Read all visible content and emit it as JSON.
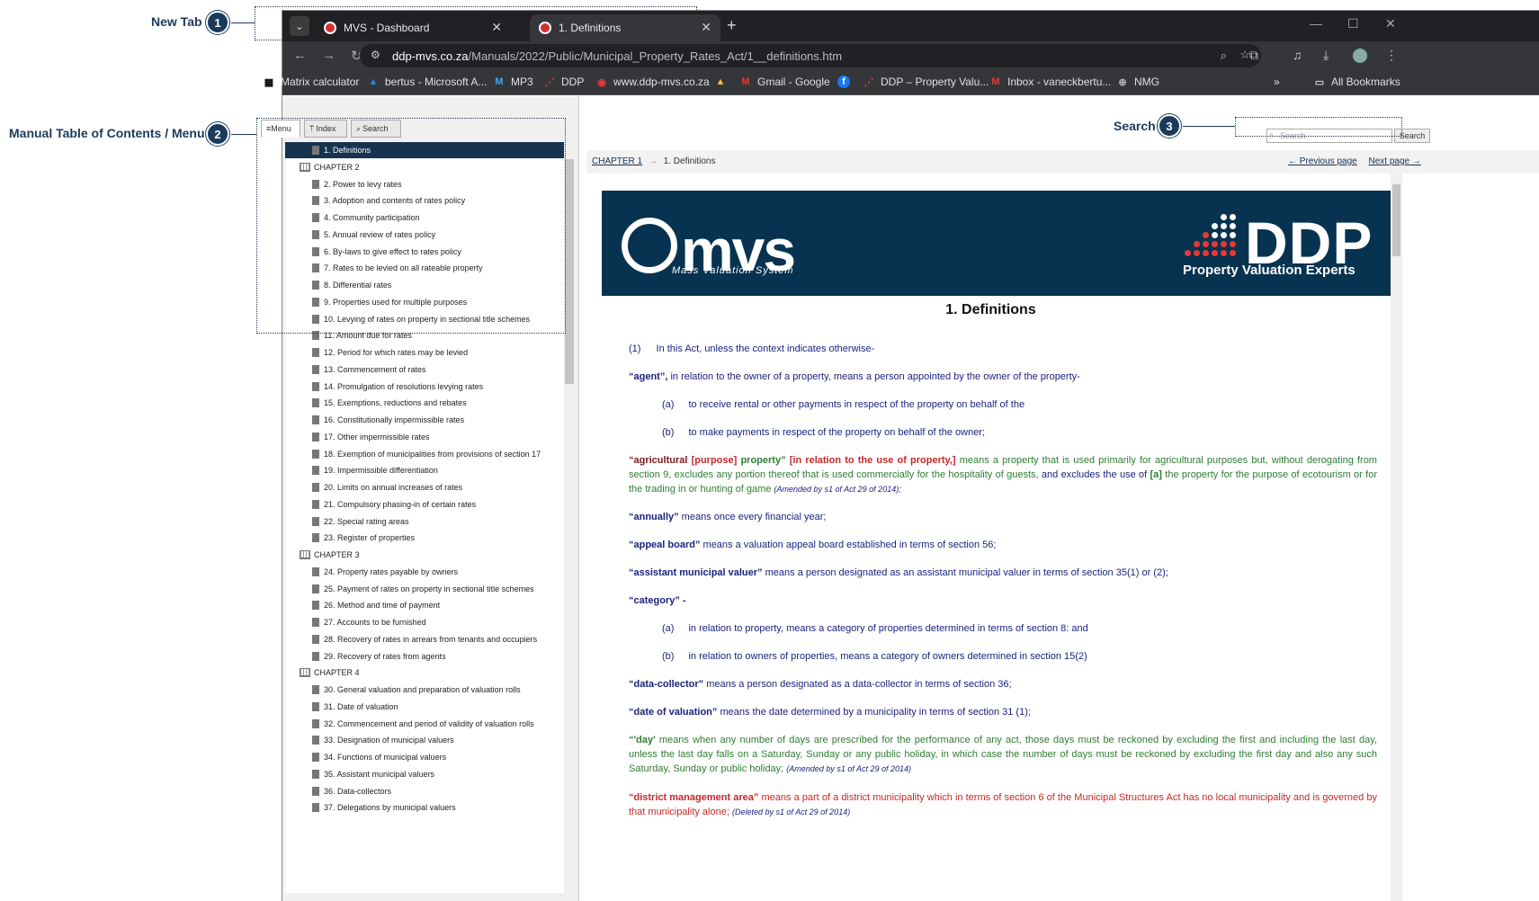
{
  "annotations": {
    "new_tab": {
      "label": "New Tab",
      "num": "1"
    },
    "toc": {
      "label": "Manual Table of Contents / Menu",
      "num": "2"
    },
    "search": {
      "label": "Search",
      "num": "3"
    }
  },
  "browser": {
    "tabs": [
      {
        "title": "MVS - Dashboard",
        "active": false
      },
      {
        "title": "1. Definitions",
        "active": true
      }
    ],
    "url_domain": "ddp-mvs.co.za",
    "url_path": "/Manuals/2022/Public/Municipal_Property_Rates_Act/1__definitions.htm",
    "bookmarks": [
      {
        "label": "Matrix calculator",
        "icon": "calc-icon"
      },
      {
        "label": "bertus - Microsoft A...",
        "icon": "azure-icon"
      },
      {
        "label": "MP3",
        "icon": "gmail-icon"
      },
      {
        "label": "DDP",
        "icon": "ddp-icon"
      },
      {
        "label": "www.ddp-mvs.co.za",
        "icon": "mvs-icon"
      },
      {
        "label": "",
        "icon": "drive-icon"
      },
      {
        "label": "Gmail - Google",
        "icon": "gmail-icon"
      },
      {
        "label": "",
        "icon": "facebook-icon"
      },
      {
        "label": "DDP – Property Valu...",
        "icon": "ddp-icon"
      },
      {
        "label": "Inbox - vaneckbertu...",
        "icon": "gmail-icon"
      },
      {
        "label": "NMG",
        "icon": "globe-icon"
      }
    ],
    "all_bookmarks": "All Bookmarks"
  },
  "panel_tabs": {
    "menu": "Menu",
    "index": "Index",
    "search": "Search"
  },
  "toc": [
    {
      "label": "1. Definitions",
      "type": "page",
      "selected": true
    },
    {
      "label": "CHAPTER 2",
      "type": "chapter"
    },
    {
      "label": "2. Power to levy rates",
      "type": "page"
    },
    {
      "label": "3. Adoption and contents of rates policy",
      "type": "page"
    },
    {
      "label": "4. Community participation",
      "type": "page"
    },
    {
      "label": "5. Annual review of rates policy",
      "type": "page"
    },
    {
      "label": "6. By-laws to give effect to rates policy",
      "type": "page"
    },
    {
      "label": "7. Rates to be levied on all rateable property",
      "type": "page"
    },
    {
      "label": "8. Differential rates",
      "type": "page"
    },
    {
      "label": "9. Properties used for multiple purposes",
      "type": "page"
    },
    {
      "label": "10. Levying of rates on property in sectional title schemes",
      "type": "page"
    },
    {
      "label": "11. Amount due for rates",
      "type": "page"
    },
    {
      "label": "12. Period for which rates may be levied",
      "type": "page"
    },
    {
      "label": "13. Commencement of rates",
      "type": "page"
    },
    {
      "label": "14. Promulgation of resolutions levying rates",
      "type": "page"
    },
    {
      "label": "15. Exemptions, reductions and rebates",
      "type": "page"
    },
    {
      "label": "16. Constitutionally impermissible rates",
      "type": "page"
    },
    {
      "label": "17. Other impermissible rates",
      "type": "page"
    },
    {
      "label": "18. Exemption of municipalities from provisions of section 17",
      "type": "page"
    },
    {
      "label": "19. Impermissible differentiation",
      "type": "page"
    },
    {
      "label": "20. Limits on annual increases of rates",
      "type": "page"
    },
    {
      "label": "21. Compulsory phasing-in of certain rates",
      "type": "page"
    },
    {
      "label": "22. Special rating areas",
      "type": "page"
    },
    {
      "label": "23. Register of properties",
      "type": "page"
    },
    {
      "label": "CHAPTER 3",
      "type": "chapter"
    },
    {
      "label": "24. Property rates payable by owners",
      "type": "page"
    },
    {
      "label": "25. Payment of rates on property in sectional title schemes",
      "type": "page"
    },
    {
      "label": "26. Method and time of payment",
      "type": "page"
    },
    {
      "label": "27. Accounts to be furnished",
      "type": "page"
    },
    {
      "label": "28. Recovery of rates in arrears from tenants and occupiers",
      "type": "page"
    },
    {
      "label": "29. Recovery of rates from agents",
      "type": "page"
    },
    {
      "label": "CHAPTER 4",
      "type": "chapter"
    },
    {
      "label": "30. General valuation and preparation of valuation rolls",
      "type": "page"
    },
    {
      "label": "31. Date of valuation",
      "type": "page"
    },
    {
      "label": "32. Commencement and period of validity of valuation rolls",
      "type": "page"
    },
    {
      "label": "33. Designation of municipal valuers",
      "type": "page"
    },
    {
      "label": "34. Functions of municipal valuers",
      "type": "page"
    },
    {
      "label": "35. Assistant municipal valuers",
      "type": "page"
    },
    {
      "label": "36. Data-collectors",
      "type": "page"
    },
    {
      "label": "37. Delegations by municipal valuers",
      "type": "page"
    }
  ],
  "search": {
    "placeholder": "Search",
    "button": "Search"
  },
  "breadcrumb": {
    "chapter": "CHAPTER 1",
    "arrow": "→",
    "page": "1. Definitions"
  },
  "nav": {
    "prev": "← Previous page",
    "next": "Next page →"
  },
  "banner": {
    "mvs": "mvs",
    "mvs_sub": "Mass Valuation System",
    "ddp": "DDP",
    "ddp_sub": "Property Valuation Experts"
  },
  "doc": {
    "title": "1. Definitions",
    "p1_num": "(1)",
    "p1": "In this Act, unless the context indicates otherwise-",
    "agent_term": "“agent”,",
    "agent_def": " in relation to the owner of a property, means a person appointed by the owner of the property-",
    "agent_a_num": "(a)",
    "agent_a": "to receive rental or other payments in respect of the property on behalf of the",
    "agent_b_num": "(b)",
    "agent_b": "to make payments in respect of the property on behalf of the owner;",
    "agri_term1": "“agricultural ",
    "agri_red1": "[purpose]",
    "agri_term2": " property”",
    "agri_red2": " [in relation to the use of property,]",
    "agri_green1": " means a property that is used primarily for agricultural purposes but, without derogating from section 9, excludes any portion thereof that is used commercially for the hospitality of guests,",
    "agri_blue": " and excludes the use of ",
    "agri_bracket": "[a]",
    "agri_green2": " the property for the purpose of ecotourism or for the trading in or hunting of game ",
    "agri_amend": "(Amended by s1 of Act 29 of 2014);",
    "annually_term": "“annually”",
    "annually_def": " means once every financial year;",
    "appeal_term": "“appeal board”",
    "appeal_def": " means a valuation appeal board established in terms of section 56;",
    "assist_term": "“assistant municipal valuer”",
    "assist_def": " means a person designated as an assistant municipal valuer in terms of section 35(1) or (2);",
    "category_term": "“category” -",
    "cat_a_num": "(a)",
    "cat_a": "in relation to property, means a category of properties determined in terms of section 8: and",
    "cat_b_num": "(b)",
    "cat_b": "in relation to owners of properties, means a category of owners determined in section 15(2)",
    "dc_term": "“data-collector”",
    "dc_def": " means a person designated as a data-collector in terms of section 36;",
    "dov_term": "“date of valuation”",
    "dov_def": " means the date determined by a municipality in terms of section 31 (1);",
    "day_term": "“'day'",
    "day_def": " means when any number of days are prescribed for the performance of any act, those days must be reckoned by excluding the first and including the last day, unless the last day falls on a Saturday, Sunday or any public holiday, in which case the number of days must be reckoned by excluding the first day and also any such Saturday, Sunday or public holiday; ",
    "day_amend": "(Amended by s1 of Act 29 of 2014)",
    "dma_term": "“district management area”",
    "dma_def": " means a part of a district municipality which in terms of section 6 of the Municipal Structures Act has no local municipality and is governed by that municipality alone; ",
    "dma_amend": "(Deleted by s1 of Act 29 of 2014)"
  }
}
